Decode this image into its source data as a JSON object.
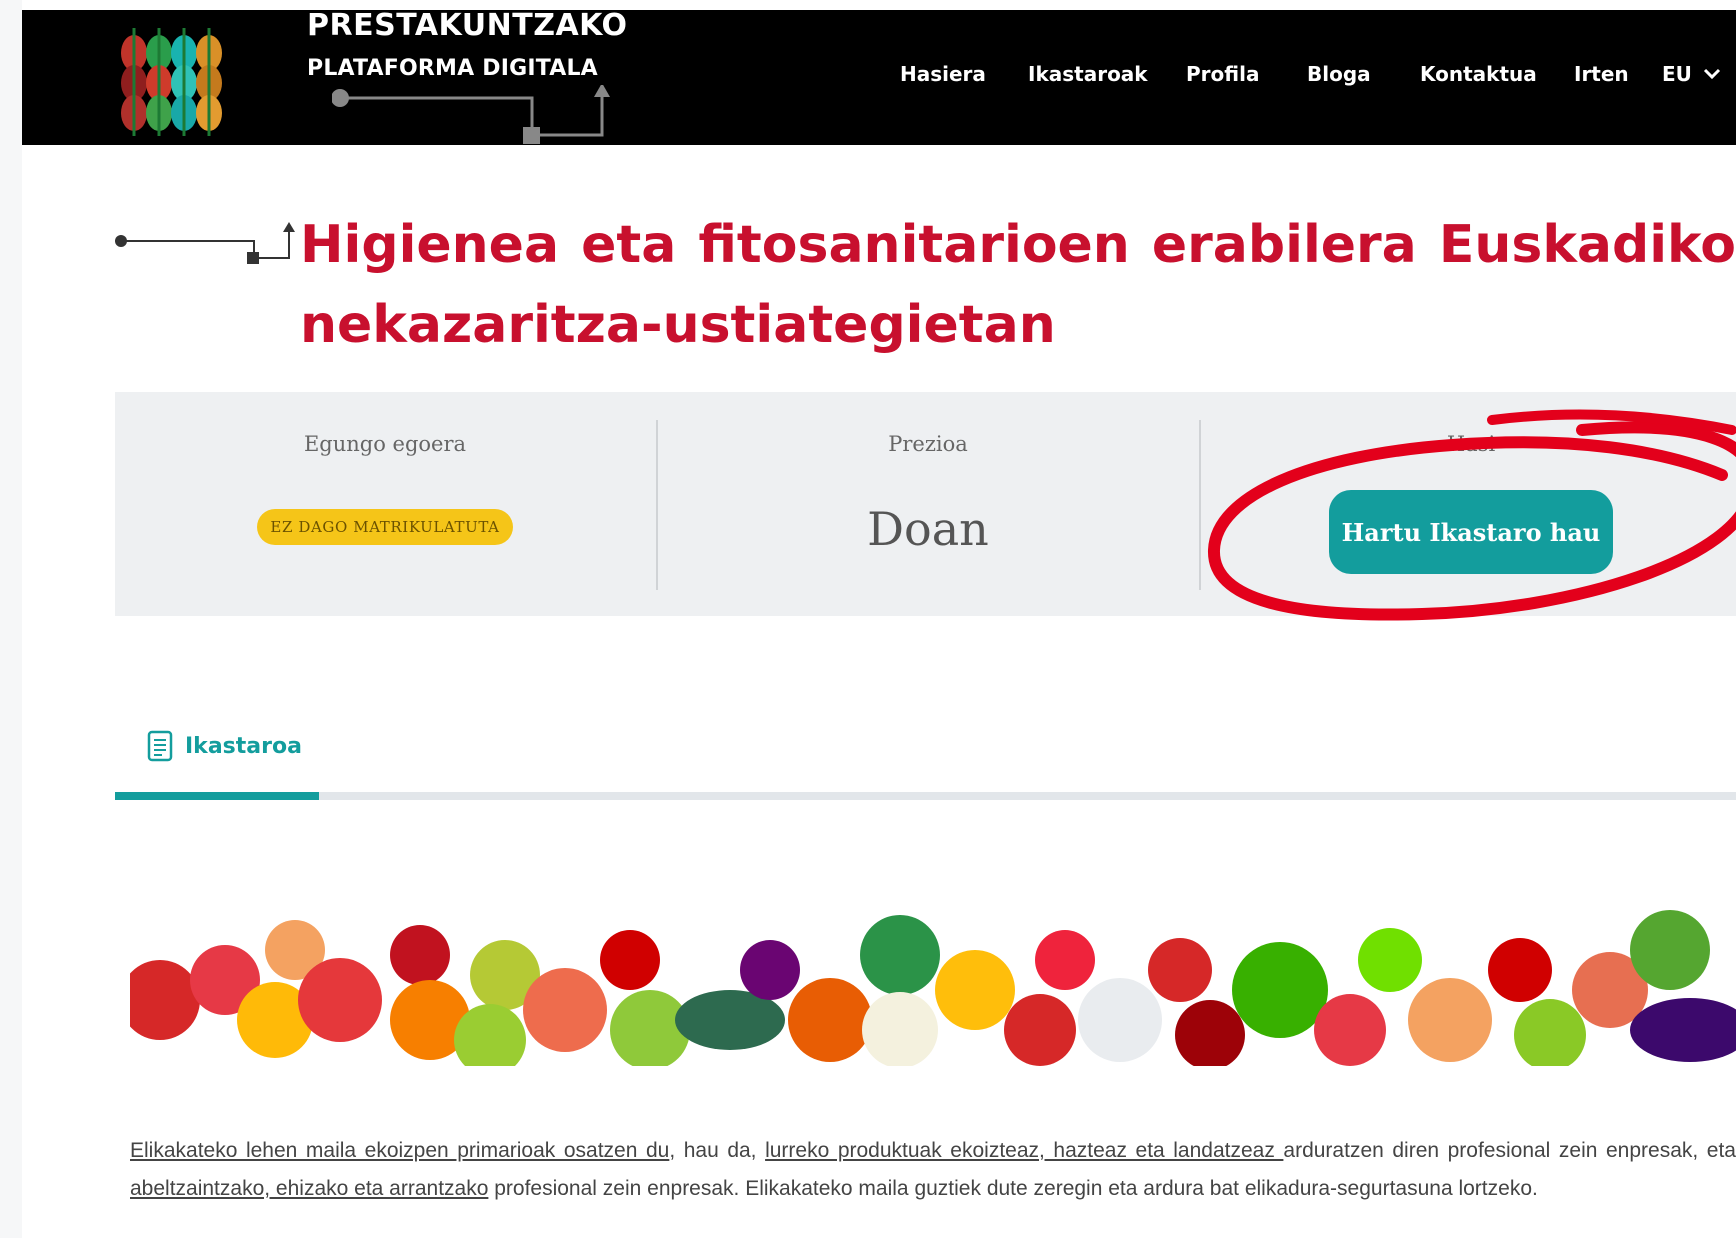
{
  "header": {
    "brand_line1": "PRESTAKUNTZAKO",
    "brand_line2": "PLATAFORMA DIGITALA",
    "nav": [
      "Hasiera",
      "Ikastaroak",
      "Profila",
      "Bloga",
      "Kontaktua",
      "Irten"
    ],
    "language": "EU",
    "language_icon": "chevron-down-icon"
  },
  "course": {
    "title_line1_words": [
      "Higienea",
      "eta",
      "fitosanitarioen",
      "erabilera",
      "Euskadiko"
    ],
    "title_line2": "nekazaritza-ustiategietan"
  },
  "info": {
    "status_label": "Egungo egoera",
    "status_badge": "EZ DAGO MATRIKULATUTA",
    "price_label": "Prezioa",
    "price_value": "Doan",
    "start_label": "Hasi",
    "cta_label": "Hartu Ikastaro hau"
  },
  "tabs": [
    {
      "label": "Ikastaroa",
      "icon": "document-icon",
      "active": true
    }
  ],
  "description": {
    "link1": "Elikakateko lehen maila ekoizpen primarioak osatzen du",
    "text1": ", hau da, ",
    "link2": "lurreko produktuak ekoizteaz, hazteaz eta landatzeaz ",
    "text2": "arduratzen diren profesional zein enpresak, eta",
    "link3": " abeltzaintzako, ehizako eta arrantzako",
    "text3": " profesional zein enpresak. Elikakateko maila guztiek dute zeregin eta ardura bat elikadura-segurtasuna lortzeko."
  },
  "colors": {
    "header_bg": "#000000",
    "title_red": "#c8102e",
    "teal": "#139d9d",
    "badge_yellow": "#f5c518",
    "info_bg": "#eef0f2",
    "highlight_red": "#e3001b"
  }
}
